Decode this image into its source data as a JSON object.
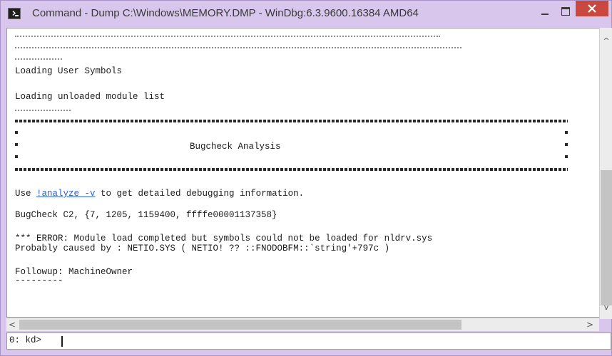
{
  "window": {
    "title": "Command - Dump C:\\Windows\\MEMORY.DMP - WinDbg:6.3.9600.16384 AMD64"
  },
  "output": {
    "loading_user_symbols": "Loading User Symbols",
    "loading_unloaded_modules": "Loading unloaded module list",
    "banner_title": "Bugcheck Analysis",
    "use_prefix": "Use ",
    "analyze_link": "!analyze -v",
    "use_suffix": " to get detailed debugging information.",
    "bugcheck": "BugCheck C2, {7, 1205, 1159400, ffffe00001137358}",
    "error_line": "*** ERROR: Module load completed but symbols could not be loaded for nldrv.sys",
    "probably_caused": "Probably caused by : NETIO.SYS ( NETIO! ?? ::FNODOBFM::`string'+797c )",
    "followup": "Followup: MachineOwner",
    "followup_rule": "---------"
  },
  "command_line": {
    "prompt": "0: kd>",
    "value": ""
  },
  "scrollbars": {
    "up_arrow": "^",
    "down_arrow": "v",
    "left_arrow": "<",
    "right_arrow": ">"
  },
  "colors": {
    "window_frame": "#d8c6ec",
    "close_button": "#c9483f",
    "link": "#2b5fd1"
  }
}
